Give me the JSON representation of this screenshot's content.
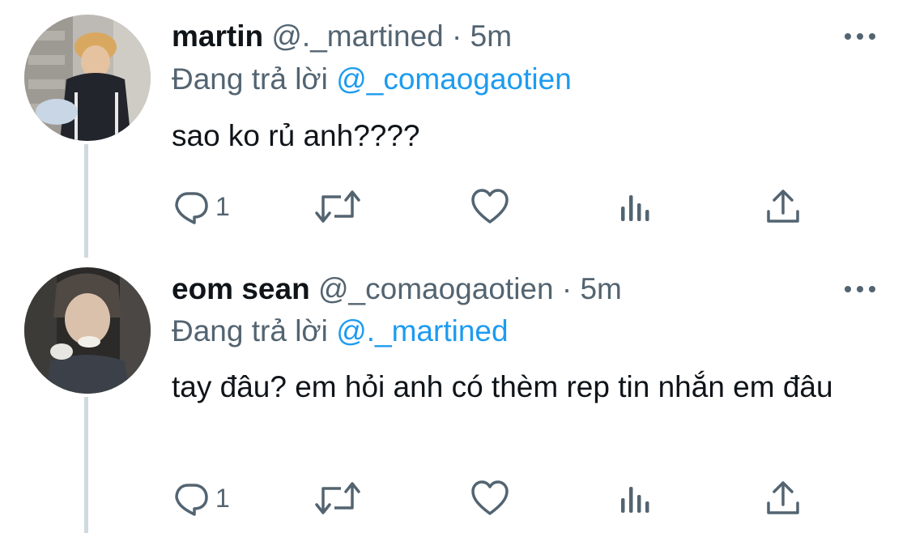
{
  "colors": {
    "text": "#0f1419",
    "secondary": "#536471",
    "accent": "#1d9bf0",
    "thread_line": "#cfd9de"
  },
  "tweets": [
    {
      "display_name": "martin",
      "handle": "@._martined",
      "separator": "·",
      "time": "5m",
      "reply_prefix": "Đang trả lời",
      "reply_to": "@_comaogaotien",
      "text": "sao ko rủ anh????",
      "reply_count": "1",
      "icons": [
        "more-icon",
        "reply-icon",
        "retweet-icon",
        "like-icon",
        "analytics-icon",
        "share-icon"
      ]
    },
    {
      "display_name": "eom sean",
      "handle": "@_comaogaotien",
      "separator": "·",
      "time": "5m",
      "reply_prefix": "Đang trả lời",
      "reply_to": "@._martined",
      "text": "tay đâu? em hỏi anh có thèm rep tin nhắn em đâu",
      "reply_count": "1",
      "icons": [
        "more-icon",
        "reply-icon",
        "retweet-icon",
        "like-icon",
        "analytics-icon",
        "share-icon"
      ]
    }
  ]
}
